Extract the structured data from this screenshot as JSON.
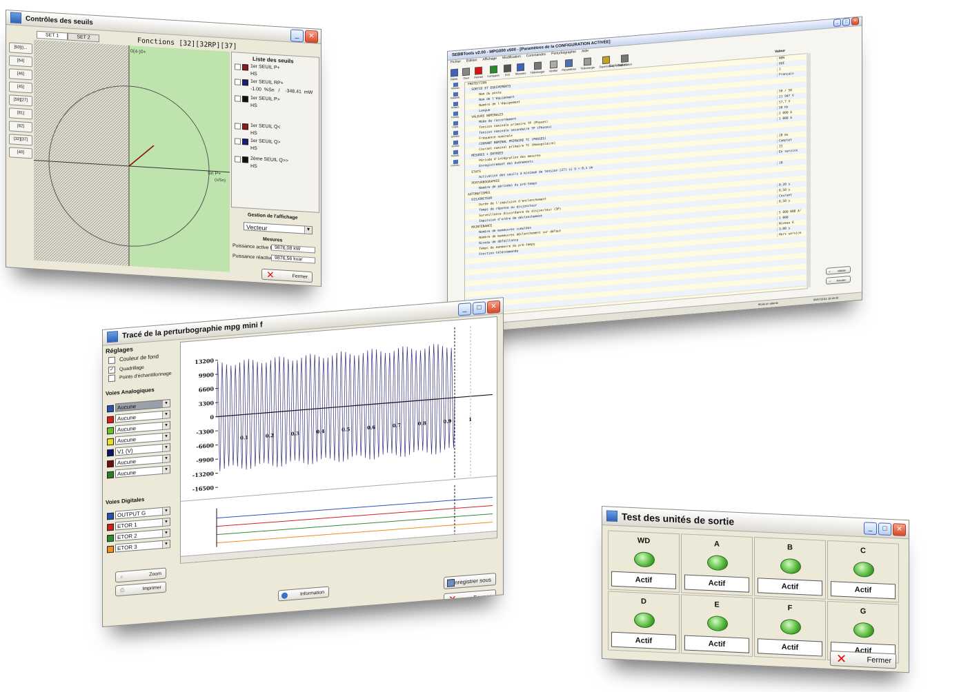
{
  "win1": {
    "title": "Contrôles des seuils",
    "tabs": [
      "SET 1",
      "SET 2"
    ],
    "functions_title": "Fonctions [32][32RP][37]",
    "side_buttons": [
      "[50]()...",
      "[64]",
      "[46]",
      "[45]",
      "[59][27]",
      "[81]",
      "[82]",
      "[32][37]",
      "[40]"
    ],
    "plot_top_label": "0(4-)0+",
    "plot_right_label1": "Sn   P+",
    "plot_right_label2": "(x/Sn)",
    "liste_title": "Liste des seuils",
    "seuils": [
      {
        "name": "1er SEUIL P+",
        "value": "HS",
        "color": "#8b1a1a"
      },
      {
        "name": "1er SEUIL RP+",
        "value": "-1.00  %Sn   /    -348.41  mW",
        "color": "#1a1a7a"
      },
      {
        "name": "1er SEUIL P>",
        "value": "HS",
        "color": "#111111"
      },
      {
        "name": "1er SEUIL Q<",
        "value": "HS",
        "color": "#8b1a1a"
      },
      {
        "name": "1er SEUIL Q>",
        "value": "HS",
        "color": "#1a1a7a"
      },
      {
        "name": "2ème SEUIL Q>>",
        "value": "HS",
        "color": "#111111"
      }
    ],
    "gestion_title": "Gestion de l'affichage",
    "gestion_select": "Vecteur",
    "mesures_title": "Mesures",
    "p_label": "Puissance active P",
    "p_value": "9876,08 kW",
    "q_label": "Puissance réactive Q",
    "q_value": "9876,56 kvar",
    "fermer": "Fermer"
  },
  "win2": {
    "title": "SEBBTools v2.00 - MPG000 v500 - [Paramètres de la CONFIGURATION ACTIVÉE]",
    "menu": [
      "Fichier",
      "Édition",
      "Affichage",
      "Modification",
      "Commandes",
      "Perturbographie",
      "Aide"
    ],
    "toolbar": [
      "Réinit.",
      "Ouvr",
      "Fermer",
      "Comparer",
      "Exit",
      "Mesures",
      "Télécharger",
      "Vérifier",
      "Paramètres",
      "Télécharger",
      "Supervision",
      "Exploitation"
    ],
    "toolbar_section": "Exploitation",
    "value_header": "Valeur",
    "side_tabs": [
      "Réseau",
      "Paramèt.",
      "Protect.",
      "Fonctio.",
      "Logiq.",
      "Entrées",
      "Sorties",
      "Perturb.",
      "Commu."
    ],
    "rows": [
      [
        "PROTECTION",
        "NON"
      ],
      [
        "  SORTIE ET EQUIPEMENTS",
        "OUI"
      ],
      [
        "      Nom du poste",
        "1"
      ],
      [
        "      Nom de l'équipement",
        "Français"
      ],
      [
        "      Numéro de l'équipement",
        ""
      ],
      [
        "      Langue",
        ""
      ],
      [
        "  VALEURS NOMINALES",
        "50 / 50"
      ],
      [
        "      Mode de raccordement",
        "21 947 V"
      ],
      [
        "      Tension nominale primaire TP (Phases)",
        "57,7 V"
      ],
      [
        "      Tension nominale secondaire TP (Phases)",
        "50 Hz"
      ],
      [
        "      Fréquence nominale",
        "2 000 A"
      ],
      [
        "      COURANT NOMINAL PRIMAIRE TC (PHASES)",
        "1 000 A"
      ],
      [
        "      Courant nominal primaire TC (Homopolaire)",
        ""
      ],
      [
        "  MESURES + ENTREES",
        ""
      ],
      [
        "      Période d'intégration des mesures",
        "20 ms"
      ],
      [
        "      Enregistrement des événements",
        "Complet"
      ],
      [
        "  ETATS",
        "II"
      ],
      [
        "      Activation des seuils à minimum de tension [27] si U < 0,1 Un",
        "En service"
      ],
      [
        "  PERTURBOGRAPHIE",
        ""
      ],
      [
        "      Nombre de périodes du pré-temps",
        "10"
      ],
      [
        "AUTOMATISMES",
        ""
      ],
      [
        "  DISJONCTEUR",
        ""
      ],
      [
        "      Durée de l'impulsion d'enclenchement",
        ""
      ],
      [
        "      Temps de réponse au disjoncteur",
        "0,20 s"
      ],
      [
        "      Surveillance discordance du disjoncteur (SP)",
        "0,50 s"
      ],
      [
        "      Impulsion d'ordre de déclenchement",
        "Courant"
      ],
      [
        "  MAINTENANCE",
        "0,50 s"
      ],
      [
        "      Nombre de manœuvres cumulées",
        ""
      ],
      [
        "      Nombre de manœuvres déclenchement sur défaut",
        "5 000 000 A²"
      ],
      [
        "      Niveau de défaillance",
        "1 000"
      ],
      [
        "      Temps de manœuvre du pré-temps",
        "Niveau 6"
      ],
      [
        "      Fonction télécommande",
        "3,00 s"
      ],
      [
        "",
        "Hors service"
      ]
    ],
    "btn_ok": "Valider",
    "btn_cancel": "Annuler",
    "status_mode": "Mode en attente",
    "status_date": "06/07/2011  16:48:30"
  },
  "win3": {
    "title": "Tracé de la perturbographie  mpg mini f",
    "reglages_title": "Réglages",
    "opt_fond": "Couleur de fond",
    "opt_quad": "Quadrillage",
    "opt_points": "Points d'échantillonnage",
    "analog_title": "Voies Analogiques",
    "analog": [
      {
        "label": "Aucune",
        "color": "#2b4fb5"
      },
      {
        "label": "Aucune",
        "color": "#d11f1f"
      },
      {
        "label": "Aucune",
        "color": "#6bbf2a"
      },
      {
        "label": "Aucune",
        "color": "#e8e020"
      },
      {
        "label": "V1 (V)",
        "color": "#0e0e66"
      },
      {
        "label": "Aucune",
        "color": "#6a1010"
      },
      {
        "label": "Aucune",
        "color": "#2e7d22"
      }
    ],
    "digital_title": "Voies Digitales",
    "digital": [
      {
        "label": "OUTPUT G",
        "color": "#2b4fb5"
      },
      {
        "label": "ETOR 1",
        "color": "#d11f1f"
      },
      {
        "label": "ETOR 2",
        "color": "#2e8b30"
      },
      {
        "label": "ETOR 3",
        "color": "#f08c20"
      }
    ],
    "yticks": [
      "13200",
      "9900",
      "6600",
      "3300",
      "0",
      "-3300",
      "-6600",
      "-9900",
      "-13200",
      "-16500"
    ],
    "xticks": [
      "0.1",
      "0.2",
      "0.3",
      "0.4",
      "0.5",
      "0.6",
      "0.7",
      "0.8",
      "0.9",
      "1"
    ],
    "zoom": "Zoom",
    "imprimer": "Imprimer",
    "information": "Information",
    "enregistrer": "Enregistrer sous",
    "fermer": "Fermer"
  },
  "win4": {
    "title": "Test des unités de sortie",
    "units": [
      "WD",
      "A",
      "B",
      "C",
      "D",
      "E",
      "F",
      "G"
    ],
    "actif": "Actif",
    "fermer": "Fermer"
  }
}
